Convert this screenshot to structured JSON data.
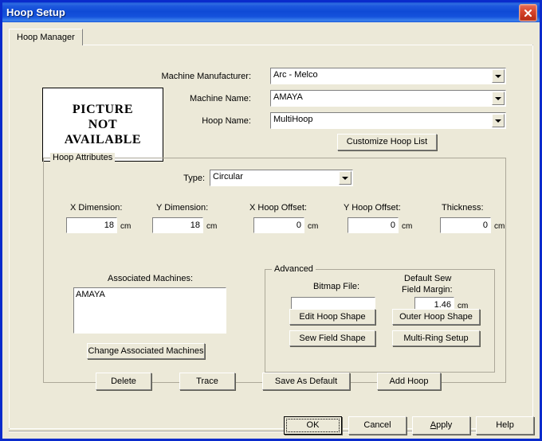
{
  "window": {
    "title": "Hoop Setup",
    "close_icon": "close-x-icon"
  },
  "tabs": [
    {
      "label": "Hoop Manager",
      "selected": true
    }
  ],
  "picture_preview": {
    "line1": "PICTURE",
    "line2": "NOT",
    "line3": "AVAILABLE"
  },
  "machine_section": {
    "manufacturer_label": "Machine Manufacturer:",
    "manufacturer_value": "Arc - Melco",
    "machine_name_label": "Machine Name:",
    "machine_name_value": "AMAYA",
    "hoop_name_label": "Hoop Name:",
    "hoop_name_value": "MultiHoop",
    "customize_button": "Customize Hoop List"
  },
  "hoop_attributes": {
    "group_title": "Hoop Attributes",
    "type_label": "Type:",
    "type_value": "Circular",
    "fields": [
      {
        "label": "X Dimension:",
        "value": "18",
        "unit": "cm"
      },
      {
        "label": "Y Dimension:",
        "value": "18",
        "unit": "cm"
      },
      {
        "label": "X Hoop Offset:",
        "value": "0",
        "unit": "cm"
      },
      {
        "label": "Y Hoop Offset:",
        "value": "0",
        "unit": "cm"
      },
      {
        "label": "Thickness:",
        "value": "0",
        "unit": "cm"
      }
    ],
    "associated_machines_label": "Associated Machines:",
    "associated_machines_items": [
      "AMAYA"
    ],
    "change_associated_button": "Change Associated Machines",
    "advanced": {
      "group_title": "Advanced",
      "bitmap_label": "Bitmap File:",
      "bitmap_value": "",
      "margin_label_line1": "Default Sew",
      "margin_label_line2": "Field Margin:",
      "margin_value": "1.46",
      "margin_unit": "cm",
      "buttons": {
        "edit_hoop_shape": "Edit Hoop Shape",
        "outer_hoop_shape": "Outer Hoop Shape",
        "sew_field_shape": "Sew Field Shape",
        "multi_ring_setup": "Multi-Ring Setup"
      }
    }
  },
  "action_buttons": {
    "delete": "Delete",
    "trace": "Trace",
    "save_as_default": "Save As Default",
    "add_hoop": "Add Hoop"
  },
  "dialog_buttons": {
    "ok": "OK",
    "cancel": "Cancel",
    "apply_accel": "A",
    "apply_rest": "pply",
    "help": "Help"
  },
  "colors": {
    "titlebar_blue": "#0F4AD6",
    "frame_blue": "#0A2BCC",
    "dialog_face": "#ECE9D8",
    "close_red": "#D7452C",
    "field_white": "#FFFFFF",
    "group_border": "#ACA899"
  }
}
